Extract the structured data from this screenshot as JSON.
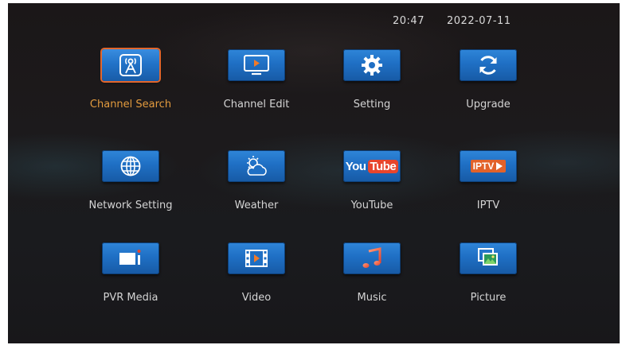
{
  "status_bar": {
    "time": "20:47",
    "date": "2022-07-11"
  },
  "colors": {
    "selected_label": "#e39b3e",
    "selected_border": "#e2662c",
    "tile_blue": "#1f6fc4",
    "label": "#d4d4d4"
  },
  "menu": {
    "selected": "Channel Search",
    "items": [
      {
        "label": "Channel Search",
        "icon": "antenna-icon"
      },
      {
        "label": "Channel Edit",
        "icon": "tv-play-icon"
      },
      {
        "label": "Setting",
        "icon": "gear-icon"
      },
      {
        "label": "Upgrade",
        "icon": "refresh-icon"
      },
      {
        "label": "Network Setting",
        "icon": "globe-icon"
      },
      {
        "label": "Weather",
        "icon": "weather-icon"
      },
      {
        "label": "YouTube",
        "icon": "youtube-logo-icon",
        "logo_text": [
          "You",
          "Tube"
        ]
      },
      {
        "label": "IPTV",
        "icon": "iptv-logo-icon",
        "logo_text": "IPTV"
      },
      {
        "label": "PVR Media",
        "icon": "record-camera-icon"
      },
      {
        "label": "Video",
        "icon": "film-play-icon"
      },
      {
        "label": "Music",
        "icon": "music-note-icon"
      },
      {
        "label": "Picture",
        "icon": "picture-icon"
      }
    ]
  }
}
